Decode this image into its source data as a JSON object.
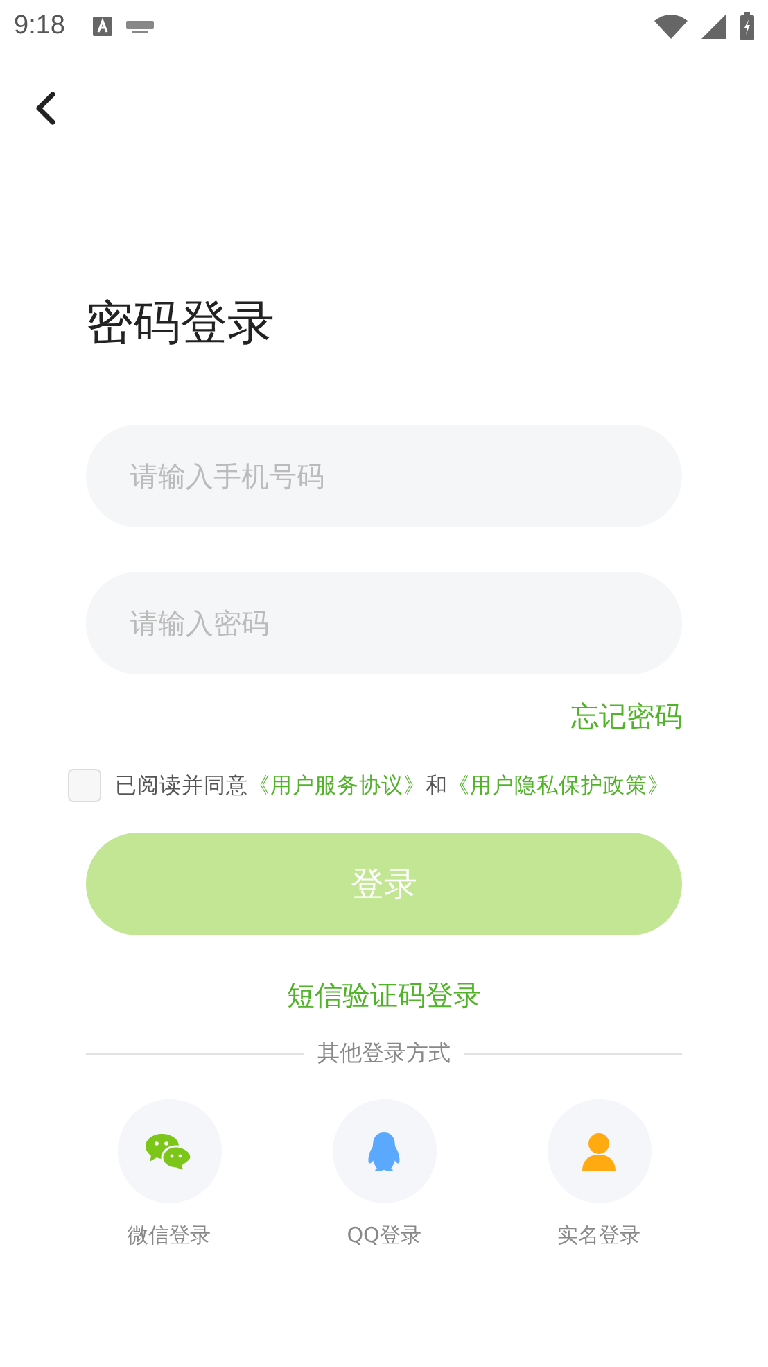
{
  "status_bar": {
    "time": "9:18"
  },
  "title": "密码登录",
  "phone_field": {
    "placeholder": "请输入手机号码"
  },
  "password_field": {
    "placeholder": "请输入密码"
  },
  "forgot_link": "忘记密码",
  "agreement": {
    "checked": false,
    "prefix": "已阅读并同意",
    "link_1": "《用户服务协议》",
    "joiner": "和",
    "link_2": "《用户隐私保护政策》"
  },
  "login_button": {
    "label": "登录",
    "disabled": true
  },
  "sms_login_link": "短信验证码登录",
  "other_methods_label": "其他登录方式",
  "other_methods": [
    {
      "kind": "wechat",
      "label": "微信登录"
    },
    {
      "kind": "qq",
      "label": "QQ登录"
    },
    {
      "kind": "person",
      "label": "实名登录"
    }
  ]
}
